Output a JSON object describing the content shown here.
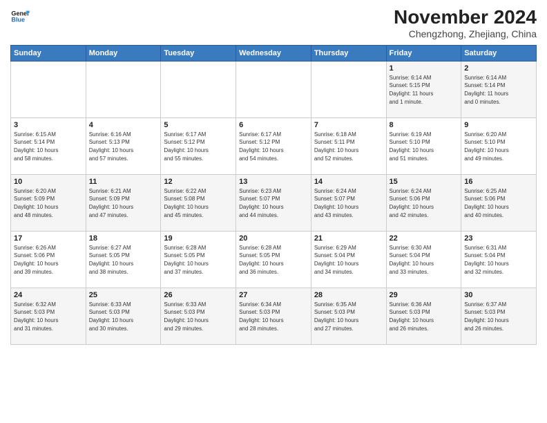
{
  "header": {
    "logo_line1": "General",
    "logo_line2": "Blue",
    "month": "November 2024",
    "location": "Chengzhong, Zhejiang, China"
  },
  "weekdays": [
    "Sunday",
    "Monday",
    "Tuesday",
    "Wednesday",
    "Thursday",
    "Friday",
    "Saturday"
  ],
  "weeks": [
    [
      {
        "day": "",
        "info": ""
      },
      {
        "day": "",
        "info": ""
      },
      {
        "day": "",
        "info": ""
      },
      {
        "day": "",
        "info": ""
      },
      {
        "day": "",
        "info": ""
      },
      {
        "day": "1",
        "info": "Sunrise: 6:14 AM\nSunset: 5:15 PM\nDaylight: 11 hours\nand 1 minute."
      },
      {
        "day": "2",
        "info": "Sunrise: 6:14 AM\nSunset: 5:14 PM\nDaylight: 11 hours\nand 0 minutes."
      }
    ],
    [
      {
        "day": "3",
        "info": "Sunrise: 6:15 AM\nSunset: 5:14 PM\nDaylight: 10 hours\nand 58 minutes."
      },
      {
        "day": "4",
        "info": "Sunrise: 6:16 AM\nSunset: 5:13 PM\nDaylight: 10 hours\nand 57 minutes."
      },
      {
        "day": "5",
        "info": "Sunrise: 6:17 AM\nSunset: 5:12 PM\nDaylight: 10 hours\nand 55 minutes."
      },
      {
        "day": "6",
        "info": "Sunrise: 6:17 AM\nSunset: 5:12 PM\nDaylight: 10 hours\nand 54 minutes."
      },
      {
        "day": "7",
        "info": "Sunrise: 6:18 AM\nSunset: 5:11 PM\nDaylight: 10 hours\nand 52 minutes."
      },
      {
        "day": "8",
        "info": "Sunrise: 6:19 AM\nSunset: 5:10 PM\nDaylight: 10 hours\nand 51 minutes."
      },
      {
        "day": "9",
        "info": "Sunrise: 6:20 AM\nSunset: 5:10 PM\nDaylight: 10 hours\nand 49 minutes."
      }
    ],
    [
      {
        "day": "10",
        "info": "Sunrise: 6:20 AM\nSunset: 5:09 PM\nDaylight: 10 hours\nand 48 minutes."
      },
      {
        "day": "11",
        "info": "Sunrise: 6:21 AM\nSunset: 5:09 PM\nDaylight: 10 hours\nand 47 minutes."
      },
      {
        "day": "12",
        "info": "Sunrise: 6:22 AM\nSunset: 5:08 PM\nDaylight: 10 hours\nand 45 minutes."
      },
      {
        "day": "13",
        "info": "Sunrise: 6:23 AM\nSunset: 5:07 PM\nDaylight: 10 hours\nand 44 minutes."
      },
      {
        "day": "14",
        "info": "Sunrise: 6:24 AM\nSunset: 5:07 PM\nDaylight: 10 hours\nand 43 minutes."
      },
      {
        "day": "15",
        "info": "Sunrise: 6:24 AM\nSunset: 5:06 PM\nDaylight: 10 hours\nand 42 minutes."
      },
      {
        "day": "16",
        "info": "Sunrise: 6:25 AM\nSunset: 5:06 PM\nDaylight: 10 hours\nand 40 minutes."
      }
    ],
    [
      {
        "day": "17",
        "info": "Sunrise: 6:26 AM\nSunset: 5:06 PM\nDaylight: 10 hours\nand 39 minutes."
      },
      {
        "day": "18",
        "info": "Sunrise: 6:27 AM\nSunset: 5:05 PM\nDaylight: 10 hours\nand 38 minutes."
      },
      {
        "day": "19",
        "info": "Sunrise: 6:28 AM\nSunset: 5:05 PM\nDaylight: 10 hours\nand 37 minutes."
      },
      {
        "day": "20",
        "info": "Sunrise: 6:28 AM\nSunset: 5:05 PM\nDaylight: 10 hours\nand 36 minutes."
      },
      {
        "day": "21",
        "info": "Sunrise: 6:29 AM\nSunset: 5:04 PM\nDaylight: 10 hours\nand 34 minutes."
      },
      {
        "day": "22",
        "info": "Sunrise: 6:30 AM\nSunset: 5:04 PM\nDaylight: 10 hours\nand 33 minutes."
      },
      {
        "day": "23",
        "info": "Sunrise: 6:31 AM\nSunset: 5:04 PM\nDaylight: 10 hours\nand 32 minutes."
      }
    ],
    [
      {
        "day": "24",
        "info": "Sunrise: 6:32 AM\nSunset: 5:03 PM\nDaylight: 10 hours\nand 31 minutes."
      },
      {
        "day": "25",
        "info": "Sunrise: 6:33 AM\nSunset: 5:03 PM\nDaylight: 10 hours\nand 30 minutes."
      },
      {
        "day": "26",
        "info": "Sunrise: 6:33 AM\nSunset: 5:03 PM\nDaylight: 10 hours\nand 29 minutes."
      },
      {
        "day": "27",
        "info": "Sunrise: 6:34 AM\nSunset: 5:03 PM\nDaylight: 10 hours\nand 28 minutes."
      },
      {
        "day": "28",
        "info": "Sunrise: 6:35 AM\nSunset: 5:03 PM\nDaylight: 10 hours\nand 27 minutes."
      },
      {
        "day": "29",
        "info": "Sunrise: 6:36 AM\nSunset: 5:03 PM\nDaylight: 10 hours\nand 26 minutes."
      },
      {
        "day": "30",
        "info": "Sunrise: 6:37 AM\nSunset: 5:03 PM\nDaylight: 10 hours\nand 26 minutes."
      }
    ]
  ]
}
